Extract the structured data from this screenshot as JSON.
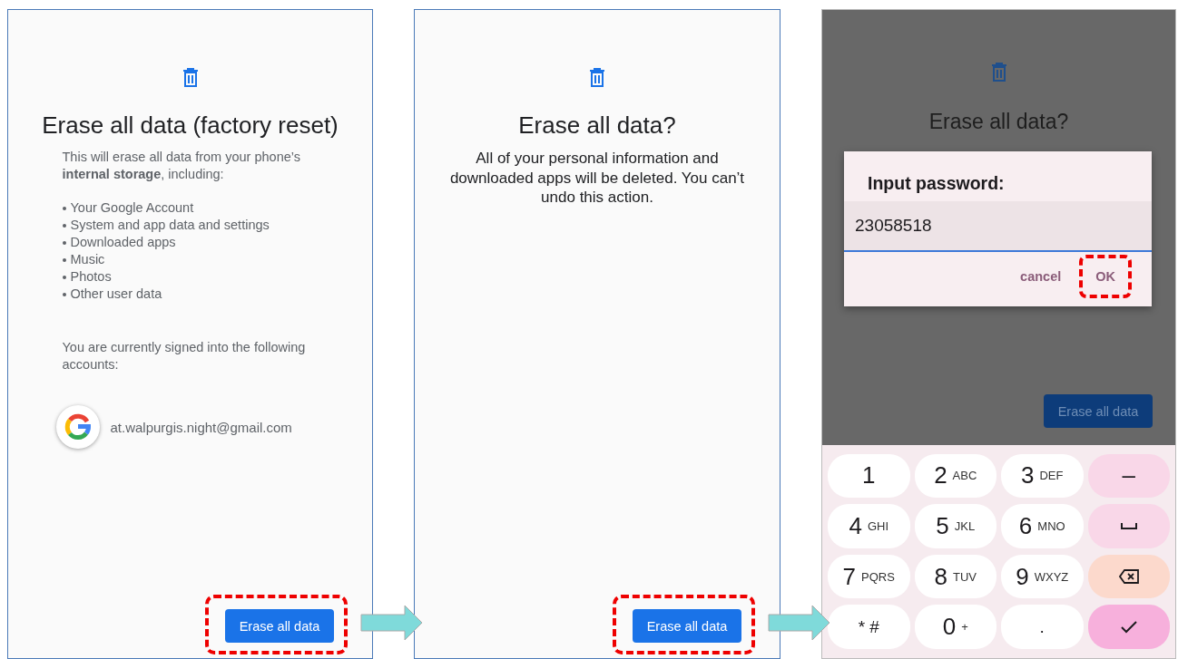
{
  "screens": [
    {
      "kind": "overview",
      "title": "Erase all data (factory reset)",
      "intro": "This will erase all data from your phone’s **internal storage**, including:",
      "items": [
        "Your Google Account",
        "System and app data and settings",
        "Downloaded apps",
        "Music",
        "Photos",
        "Other user data"
      ],
      "accounts_note": "You are currently signed into the following accounts:",
      "account": "at.walpurgis.night@gmail.com",
      "button": "Erase all data",
      "highlighted": true
    },
    {
      "kind": "confirm",
      "title": "Erase all data?",
      "body": "All of your personal information and downloaded apps will be deleted. You can’t undo this action.",
      "button": "Erase all data",
      "highlighted": true
    },
    {
      "kind": "password",
      "title": "Erase all data?",
      "button": "Erase all data",
      "dialog": {
        "title": "Input password:",
        "value": "23058518",
        "actions": [
          {
            "label": "cancel",
            "highlighted": false
          },
          {
            "label": "OK",
            "highlighted": true
          }
        ]
      },
      "keys": [
        {
          "kind": "digit",
          "label": "1"
        },
        {
          "kind": "digit",
          "label": "2",
          "letters": "ABC"
        },
        {
          "kind": "digit",
          "label": "3",
          "letters": "DEF"
        },
        {
          "kind": "minus",
          "label": "–"
        },
        {
          "kind": "digit",
          "label": "4",
          "letters": "GHI"
        },
        {
          "kind": "digit",
          "label": "5",
          "letters": "JKL"
        },
        {
          "kind": "digit",
          "label": "6",
          "letters": "MNO"
        },
        {
          "kind": "space"
        },
        {
          "kind": "digit",
          "label": "7",
          "letters": "PQRS"
        },
        {
          "kind": "digit",
          "label": "8",
          "letters": "TUV"
        },
        {
          "kind": "digit",
          "label": "9",
          "letters": "WXYZ"
        },
        {
          "kind": "backspace"
        },
        {
          "kind": "symbol",
          "label": "* #"
        },
        {
          "kind": "digit",
          "label": "0",
          "letters": "+"
        },
        {
          "kind": "symbol",
          "label": "."
        },
        {
          "kind": "done"
        }
      ]
    }
  ]
}
